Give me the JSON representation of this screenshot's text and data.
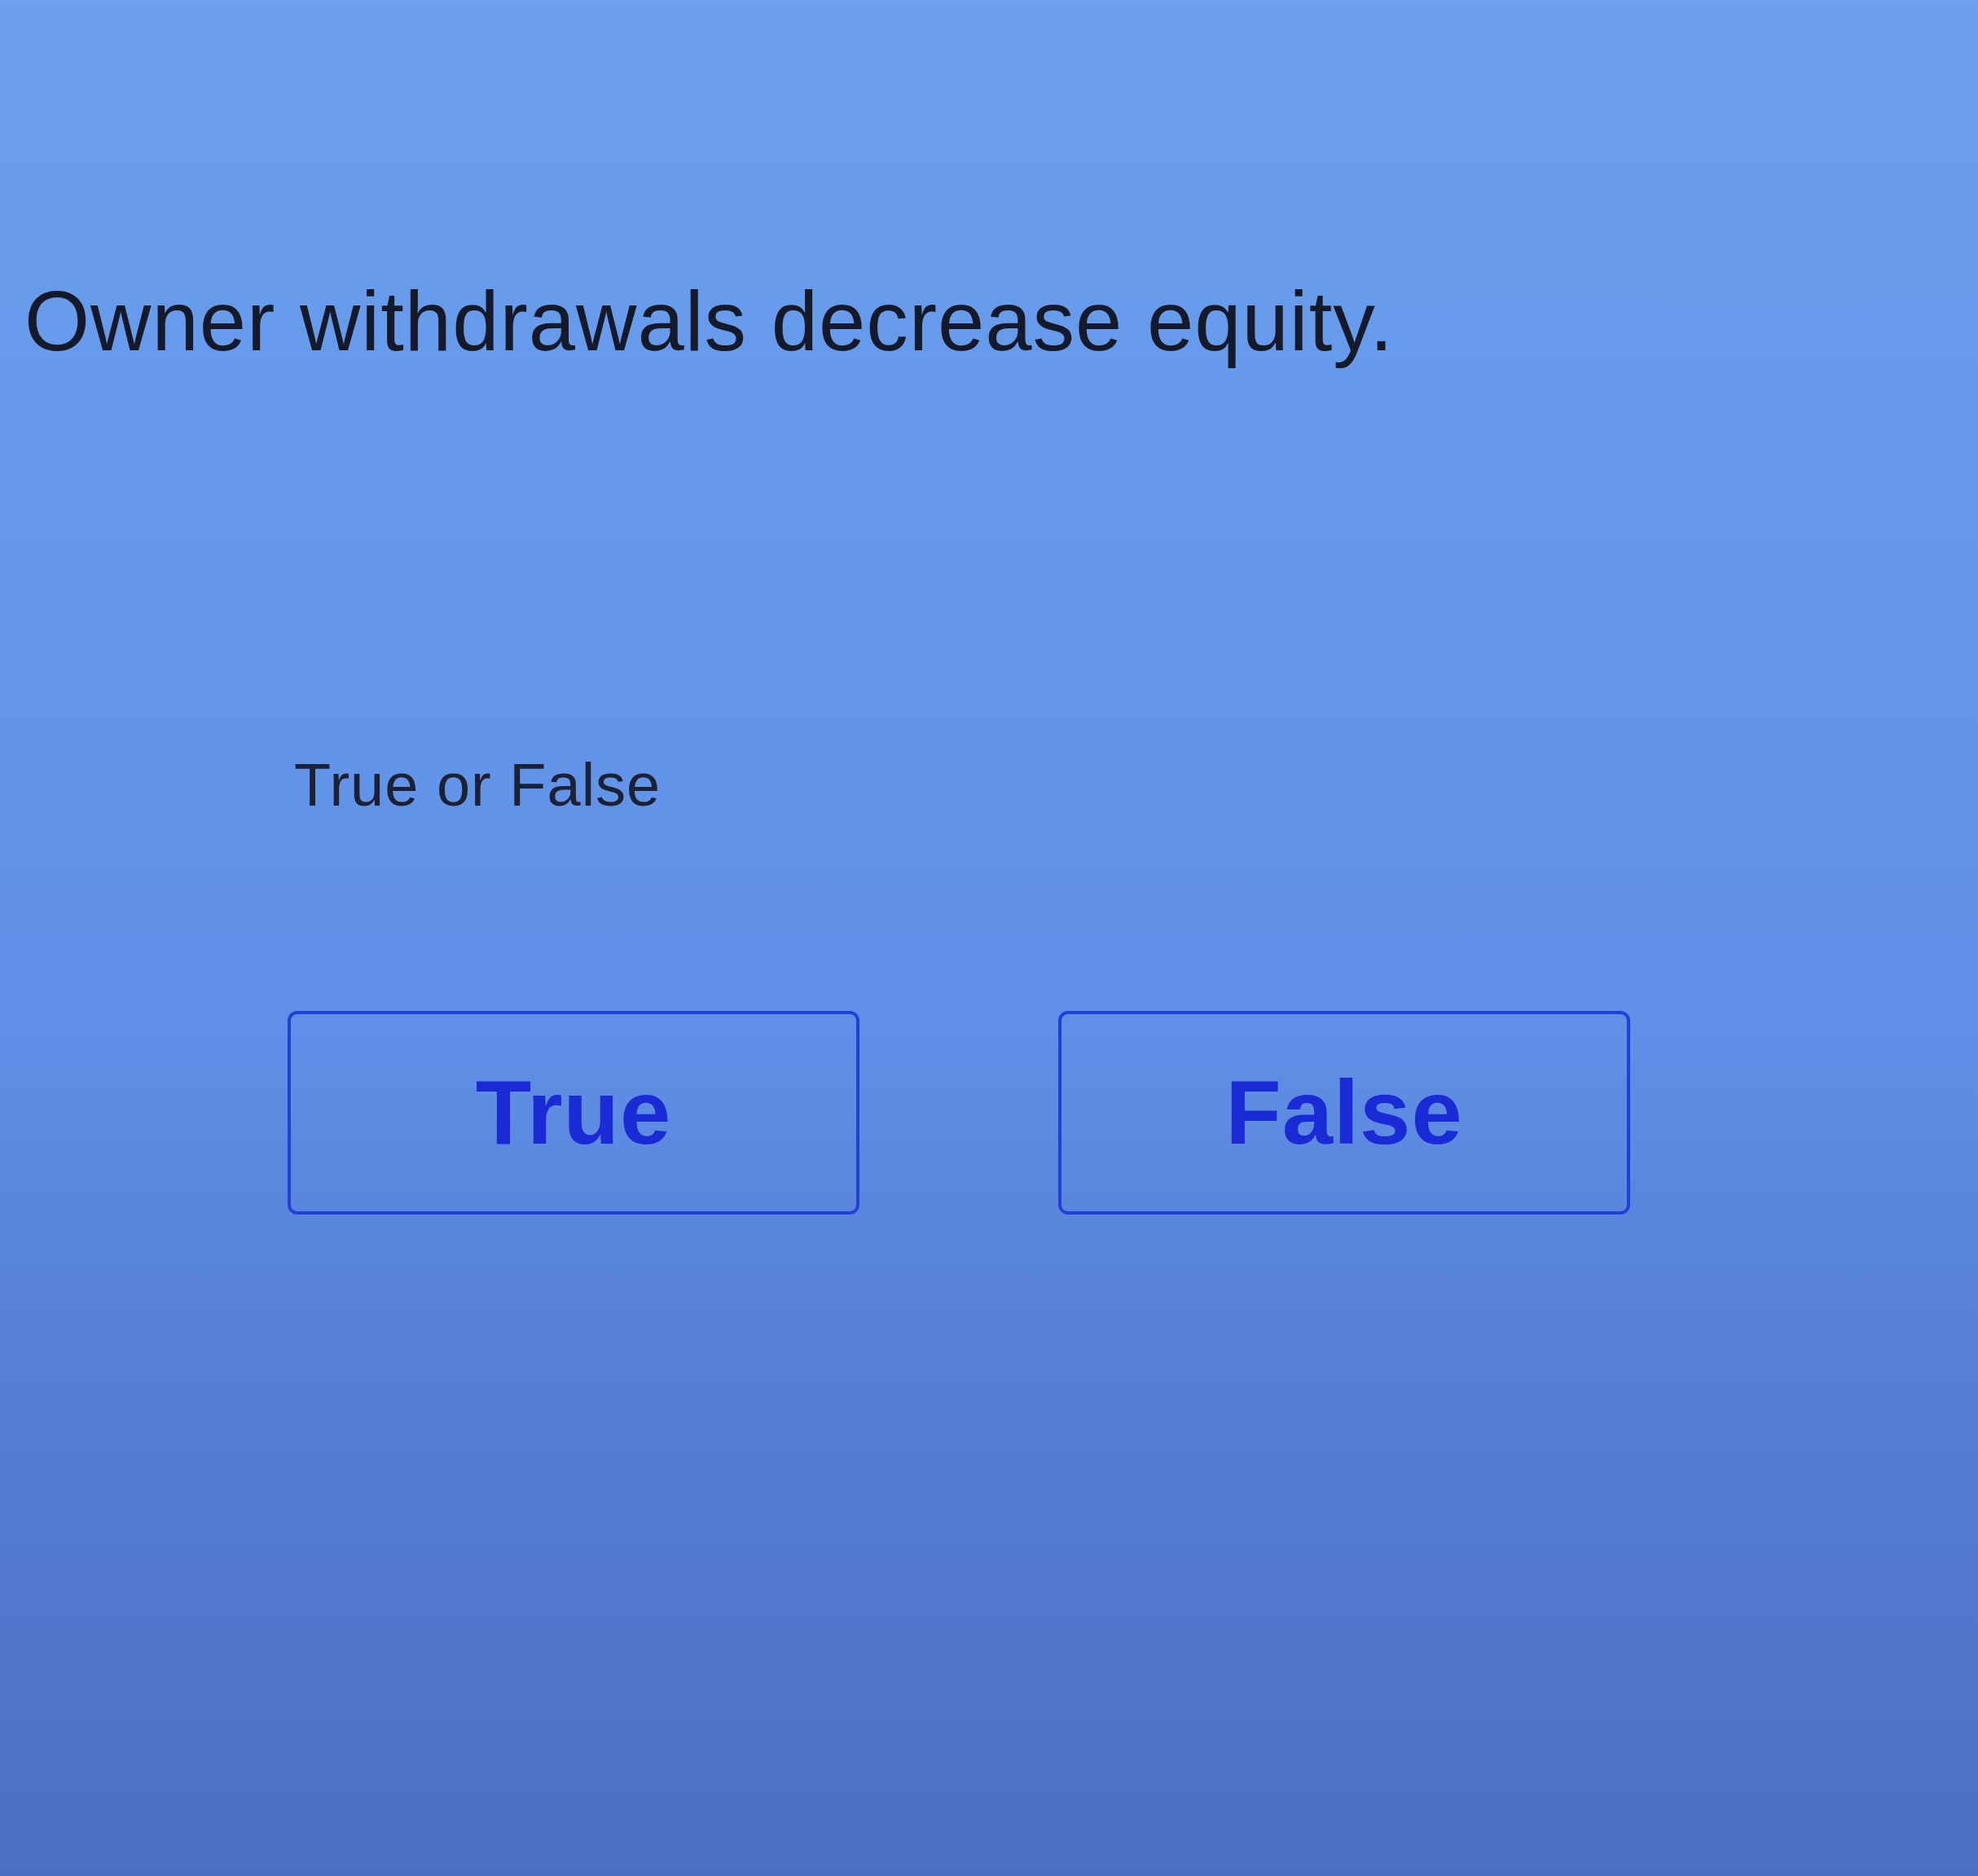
{
  "question": {
    "text": "Owner withdrawals decrease equity."
  },
  "prompt": "True or False",
  "options": [
    {
      "label": "True",
      "selected": false
    },
    {
      "label": "False",
      "selected": false
    }
  ]
}
